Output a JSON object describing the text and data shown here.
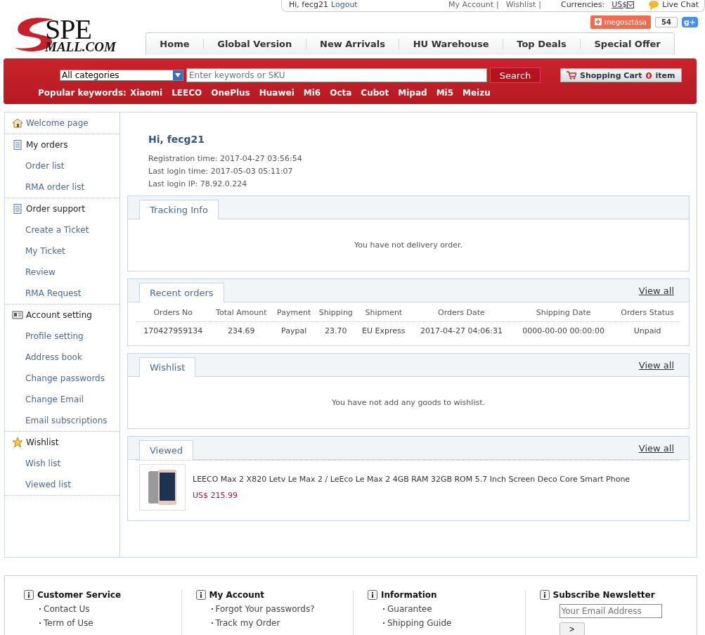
{
  "top_bar": {
    "greeting": "Hi, fecg21",
    "logout": "Logout",
    "links": [
      "My Account",
      "Wishlist"
    ],
    "separator": "|",
    "currency_label": "Currencies:",
    "currency": "US$",
    "live_chat": "Live Chat"
  },
  "logo": {
    "line1": "SPE",
    "line2": "MALL.COM"
  },
  "share": {
    "label": "megosztása",
    "count": "54",
    "gplus": "g+"
  },
  "nav": [
    "Home",
    "Global Version",
    "New Arrivals",
    "HU Warehouse",
    "Top Deals",
    "Special Offer"
  ],
  "search": {
    "category": "All categories",
    "placeholder": "Enter keywords or SKU",
    "button": "Search",
    "cart_label": "Shopping Cart",
    "cart_count": "0",
    "cart_unit": "item"
  },
  "popular": {
    "label": "Popular keywords:",
    "keywords": [
      "Xiaomi",
      "LEECO",
      "OnePlus",
      "Huawei",
      "Mi6",
      "Octa",
      "Cubot",
      "Mipad",
      "Mi5",
      "Meizu"
    ]
  },
  "sidebar": [
    {
      "label": "Welcome page",
      "kind": "home"
    },
    {
      "label": "My orders",
      "kind": "document",
      "children": [
        {
          "label": "Order list"
        },
        {
          "label": "RMA order list"
        }
      ]
    },
    {
      "label": "Order support",
      "kind": "document",
      "children": [
        {
          "label": "Create a Ticket"
        },
        {
          "label": "My Ticket"
        },
        {
          "label": "Review"
        },
        {
          "label": "RMA Request"
        }
      ]
    },
    {
      "label": "Account setting",
      "kind": "account",
      "children": [
        {
          "label": "Profile setting"
        },
        {
          "label": "Address book"
        },
        {
          "label": "Change passwords"
        },
        {
          "label": "Change Email"
        },
        {
          "label": "Email subscriptions"
        }
      ]
    },
    {
      "label": "Wishlist",
      "kind": "wishlist",
      "children": [
        {
          "label": "Wish list"
        },
        {
          "label": "Viewed list"
        }
      ]
    }
  ],
  "welcome": {
    "title": "Hi, fecg21",
    "lines": [
      "Registration time: 2017-04-27 03:56:54",
      "Last login time: 2017-05-03 05:11:07",
      "Last login IP: 78.92.0.224"
    ]
  },
  "panels": [
    {
      "kind": "message",
      "tab": "Tracking Info",
      "message": "You have not delivery order."
    },
    {
      "kind": "orders",
      "tab": "Recent orders",
      "view_all": "View all",
      "columns": [
        "Orders No",
        "Total Amount",
        "Payment",
        "Shipping",
        "Shipment",
        "Orders Date",
        "Shipping Date",
        "Orders Status"
      ],
      "rows": [
        [
          "170427959134",
          "234.69",
          "Paypal",
          "23.70",
          "EU Express",
          "2017-04-27 04:06:31",
          "0000-00-00 00:00:00",
          "Unpaid"
        ]
      ]
    },
    {
      "kind": "message",
      "tab": "Wishlist",
      "view_all": "View all",
      "message": "You have not add any goods to wishlist."
    },
    {
      "kind": "viewed",
      "tab": "Viewed",
      "view_all": "View all",
      "items": [
        {
          "title": "LEECO Max 2 X820 Letv Le Max 2 / LeEco Le Max 2 4GB RAM 32GB ROM 5.7 Inch Screen Deco Core Smart Phone",
          "price": "US$ 215.99"
        }
      ]
    }
  ],
  "footer": [
    {
      "title": "Customer Service",
      "links": [
        "Contact Us",
        "Term of Use"
      ]
    },
    {
      "title": "My Account",
      "links": [
        "Forgot Your passwords?",
        "Track my Order"
      ]
    },
    {
      "title": "Information",
      "links": [
        "Guarantee",
        "Shipping Guide"
      ]
    },
    {
      "title": "Subscribe Newsletter",
      "placeholder": "Your Email Address",
      "button": ">"
    }
  ]
}
